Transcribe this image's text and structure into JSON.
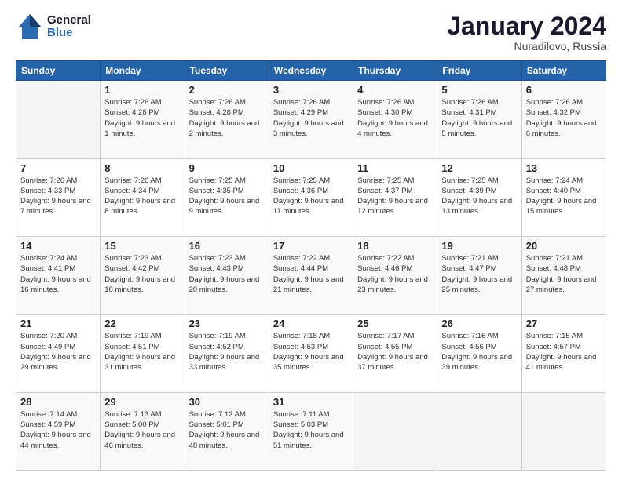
{
  "header": {
    "logo_line1": "General",
    "logo_line2": "Blue",
    "month": "January 2024",
    "location": "Nuradilovo, Russia"
  },
  "weekdays": [
    "Sunday",
    "Monday",
    "Tuesday",
    "Wednesday",
    "Thursday",
    "Friday",
    "Saturday"
  ],
  "weeks": [
    [
      {
        "day": "",
        "sunrise": "",
        "sunset": "",
        "daylight": ""
      },
      {
        "day": "1",
        "sunrise": "Sunrise: 7:26 AM",
        "sunset": "Sunset: 4:28 PM",
        "daylight": "Daylight: 9 hours and 1 minute."
      },
      {
        "day": "2",
        "sunrise": "Sunrise: 7:26 AM",
        "sunset": "Sunset: 4:28 PM",
        "daylight": "Daylight: 9 hours and 2 minutes."
      },
      {
        "day": "3",
        "sunrise": "Sunrise: 7:26 AM",
        "sunset": "Sunset: 4:29 PM",
        "daylight": "Daylight: 9 hours and 3 minutes."
      },
      {
        "day": "4",
        "sunrise": "Sunrise: 7:26 AM",
        "sunset": "Sunset: 4:30 PM",
        "daylight": "Daylight: 9 hours and 4 minutes."
      },
      {
        "day": "5",
        "sunrise": "Sunrise: 7:26 AM",
        "sunset": "Sunset: 4:31 PM",
        "daylight": "Daylight: 9 hours and 5 minutes."
      },
      {
        "day": "6",
        "sunrise": "Sunrise: 7:26 AM",
        "sunset": "Sunset: 4:32 PM",
        "daylight": "Daylight: 9 hours and 6 minutes."
      }
    ],
    [
      {
        "day": "7",
        "sunrise": "Sunrise: 7:26 AM",
        "sunset": "Sunset: 4:33 PM",
        "daylight": "Daylight: 9 hours and 7 minutes."
      },
      {
        "day": "8",
        "sunrise": "Sunrise: 7:26 AM",
        "sunset": "Sunset: 4:34 PM",
        "daylight": "Daylight: 9 hours and 8 minutes."
      },
      {
        "day": "9",
        "sunrise": "Sunrise: 7:25 AM",
        "sunset": "Sunset: 4:35 PM",
        "daylight": "Daylight: 9 hours and 9 minutes."
      },
      {
        "day": "10",
        "sunrise": "Sunrise: 7:25 AM",
        "sunset": "Sunset: 4:36 PM",
        "daylight": "Daylight: 9 hours and 11 minutes."
      },
      {
        "day": "11",
        "sunrise": "Sunrise: 7:25 AM",
        "sunset": "Sunset: 4:37 PM",
        "daylight": "Daylight: 9 hours and 12 minutes."
      },
      {
        "day": "12",
        "sunrise": "Sunrise: 7:25 AM",
        "sunset": "Sunset: 4:39 PM",
        "daylight": "Daylight: 9 hours and 13 minutes."
      },
      {
        "day": "13",
        "sunrise": "Sunrise: 7:24 AM",
        "sunset": "Sunset: 4:40 PM",
        "daylight": "Daylight: 9 hours and 15 minutes."
      }
    ],
    [
      {
        "day": "14",
        "sunrise": "Sunrise: 7:24 AM",
        "sunset": "Sunset: 4:41 PM",
        "daylight": "Daylight: 9 hours and 16 minutes."
      },
      {
        "day": "15",
        "sunrise": "Sunrise: 7:23 AM",
        "sunset": "Sunset: 4:42 PM",
        "daylight": "Daylight: 9 hours and 18 minutes."
      },
      {
        "day": "16",
        "sunrise": "Sunrise: 7:23 AM",
        "sunset": "Sunset: 4:43 PM",
        "daylight": "Daylight: 9 hours and 20 minutes."
      },
      {
        "day": "17",
        "sunrise": "Sunrise: 7:22 AM",
        "sunset": "Sunset: 4:44 PM",
        "daylight": "Daylight: 9 hours and 21 minutes."
      },
      {
        "day": "18",
        "sunrise": "Sunrise: 7:22 AM",
        "sunset": "Sunset: 4:46 PM",
        "daylight": "Daylight: 9 hours and 23 minutes."
      },
      {
        "day": "19",
        "sunrise": "Sunrise: 7:21 AM",
        "sunset": "Sunset: 4:47 PM",
        "daylight": "Daylight: 9 hours and 25 minutes."
      },
      {
        "day": "20",
        "sunrise": "Sunrise: 7:21 AM",
        "sunset": "Sunset: 4:48 PM",
        "daylight": "Daylight: 9 hours and 27 minutes."
      }
    ],
    [
      {
        "day": "21",
        "sunrise": "Sunrise: 7:20 AM",
        "sunset": "Sunset: 4:49 PM",
        "daylight": "Daylight: 9 hours and 29 minutes."
      },
      {
        "day": "22",
        "sunrise": "Sunrise: 7:19 AM",
        "sunset": "Sunset: 4:51 PM",
        "daylight": "Daylight: 9 hours and 31 minutes."
      },
      {
        "day": "23",
        "sunrise": "Sunrise: 7:19 AM",
        "sunset": "Sunset: 4:52 PM",
        "daylight": "Daylight: 9 hours and 33 minutes."
      },
      {
        "day": "24",
        "sunrise": "Sunrise: 7:18 AM",
        "sunset": "Sunset: 4:53 PM",
        "daylight": "Daylight: 9 hours and 35 minutes."
      },
      {
        "day": "25",
        "sunrise": "Sunrise: 7:17 AM",
        "sunset": "Sunset: 4:55 PM",
        "daylight": "Daylight: 9 hours and 37 minutes."
      },
      {
        "day": "26",
        "sunrise": "Sunrise: 7:16 AM",
        "sunset": "Sunset: 4:56 PM",
        "daylight": "Daylight: 9 hours and 39 minutes."
      },
      {
        "day": "27",
        "sunrise": "Sunrise: 7:15 AM",
        "sunset": "Sunset: 4:57 PM",
        "daylight": "Daylight: 9 hours and 41 minutes."
      }
    ],
    [
      {
        "day": "28",
        "sunrise": "Sunrise: 7:14 AM",
        "sunset": "Sunset: 4:59 PM",
        "daylight": "Daylight: 9 hours and 44 minutes."
      },
      {
        "day": "29",
        "sunrise": "Sunrise: 7:13 AM",
        "sunset": "Sunset: 5:00 PM",
        "daylight": "Daylight: 9 hours and 46 minutes."
      },
      {
        "day": "30",
        "sunrise": "Sunrise: 7:12 AM",
        "sunset": "Sunset: 5:01 PM",
        "daylight": "Daylight: 9 hours and 48 minutes."
      },
      {
        "day": "31",
        "sunrise": "Sunrise: 7:11 AM",
        "sunset": "Sunset: 5:03 PM",
        "daylight": "Daylight: 9 hours and 51 minutes."
      },
      {
        "day": "",
        "sunrise": "",
        "sunset": "",
        "daylight": ""
      },
      {
        "day": "",
        "sunrise": "",
        "sunset": "",
        "daylight": ""
      },
      {
        "day": "",
        "sunrise": "",
        "sunset": "",
        "daylight": ""
      }
    ]
  ]
}
